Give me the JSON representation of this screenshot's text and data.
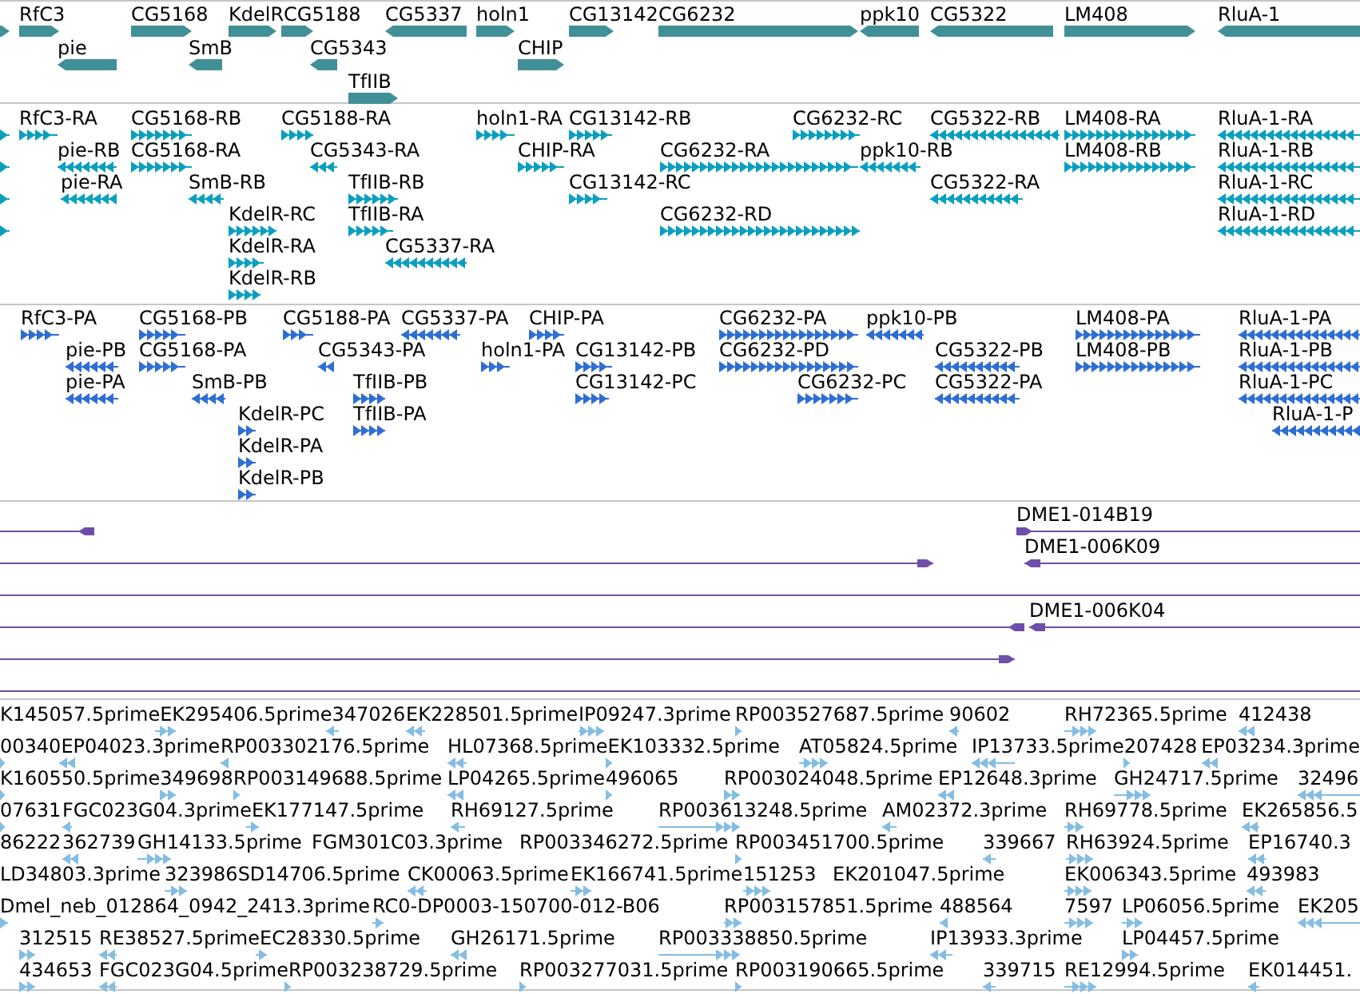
{
  "tracks": [
    {
      "kind": "gene",
      "rows": [
        {
          "features": [
            {
              "reverse": false
            },
            {
              "label": "RfC3",
              "reverse": false
            },
            {
              "label": "CG5168",
              "reverse": false
            },
            {
              "label": "KdelR",
              "reverse": false
            },
            {
              "label": "CG5188",
              "reverse": false
            },
            {
              "label": "CG5337",
              "reverse": true
            },
            {
              "label": "holn1",
              "reverse": false
            },
            {
              "label": "CG13142",
              "reverse": false
            },
            {
              "label": "CG6232",
              "reverse": false
            },
            {
              "label": "ppk10",
              "reverse": true
            },
            {
              "label": "CG5322",
              "reverse": true
            },
            {
              "label": "LM408",
              "reverse": false
            },
            {
              "label": "RluA-1",
              "reverse": true
            }
          ]
        },
        {
          "features": [
            {
              "label": "pie",
              "reverse": true
            },
            {
              "label": "SmB",
              "reverse": true
            },
            {
              "label": "CG5343",
              "reverse": true
            },
            {
              "label": "CHIP",
              "reverse": false
            }
          ]
        },
        {
          "features": [
            {
              "label": "TfIIB",
              "reverse": false
            }
          ]
        }
      ]
    },
    {
      "kind": "transcript",
      "rows": [
        {
          "features": [
            {
              "reverse": false
            },
            {
              "label": "RfC3-RA",
              "reverse": false
            },
            {
              "label": "CG5168-RB",
              "reverse": false
            },
            {
              "label": "CG5188-RA",
              "reverse": false
            },
            {
              "label": "holn1-RA",
              "reverse": false
            },
            {
              "label": "CG13142-RB",
              "reverse": false
            },
            {
              "label": "CG6232-RC",
              "reverse": false
            },
            {
              "label": "CG5322-RB",
              "reverse": true
            },
            {
              "label": "LM408-RA",
              "reverse": false
            },
            {
              "label": "RluA-1-RA",
              "reverse": true
            }
          ]
        },
        {
          "features": [
            {
              "reverse": false
            },
            {
              "label": "pie-RB",
              "reverse": true
            },
            {
              "label": "CG5168-RA",
              "reverse": false
            },
            {
              "label": "CG5343-RA",
              "reverse": true
            },
            {
              "label": "CHIP-RA",
              "reverse": false
            },
            {
              "label": "CG6232-RA",
              "reverse": false
            },
            {
              "label": "ppk10-RB",
              "reverse": true
            },
            {
              "label": "LM408-RB",
              "reverse": false
            },
            {
              "label": "RluA-1-RB",
              "reverse": true
            }
          ]
        },
        {
          "features": [
            {
              "reverse": false
            },
            {
              "label": "pie-RA",
              "reverse": true
            },
            {
              "label": "SmB-RB",
              "reverse": true
            },
            {
              "label": "TfIIB-RB",
              "reverse": false
            },
            {
              "label": "CG13142-RC",
              "reverse": false
            },
            {
              "label": "CG5322-RA",
              "reverse": true
            },
            {
              "label": "RluA-1-RC",
              "reverse": true
            }
          ]
        },
        {
          "features": [
            {
              "reverse": false
            },
            {
              "label": "KdelR-RC",
              "reverse": false
            },
            {
              "label": "TfIIB-RA",
              "reverse": false
            },
            {
              "label": "CG6232-RD",
              "reverse": false
            },
            {
              "label": "RluA-1-RD",
              "reverse": true
            }
          ]
        },
        {
          "features": [
            {
              "label": "KdelR-RA",
              "reverse": false
            },
            {
              "label": "CG5337-RA",
              "reverse": true
            }
          ]
        },
        {
          "features": [
            {
              "label": "KdelR-RB",
              "reverse": false
            }
          ]
        }
      ]
    },
    {
      "kind": "protein",
      "rows": [
        {
          "features": [
            {
              "label": "RfC3-PA",
              "reverse": false
            },
            {
              "label": "CG5168-PB",
              "reverse": false
            },
            {
              "label": "CG5188-PA",
              "reverse": false
            },
            {
              "label": "CG5337-PA",
              "reverse": true
            },
            {
              "label": "CHIP-PA",
              "reverse": false
            },
            {
              "label": "CG6232-PA",
              "reverse": false
            },
            {
              "label": "ppk10-PB",
              "reverse": true
            },
            {
              "label": "LM408-PA",
              "reverse": false
            },
            {
              "label": "RluA-1-PA",
              "reverse": true
            }
          ]
        },
        {
          "features": [
            {
              "label": "pie-PB",
              "reverse": true
            },
            {
              "label": "CG5168-PA",
              "reverse": false
            },
            {
              "label": "CG5343-PA",
              "reverse": true
            },
            {
              "label": "holn1-PA",
              "reverse": false
            },
            {
              "label": "CG13142-PB",
              "reverse": false
            },
            {
              "label": "CG6232-PD",
              "reverse": false
            },
            {
              "label": "CG5322-PB",
              "reverse": true
            },
            {
              "label": "LM408-PB",
              "reverse": false
            },
            {
              "label": "RluA-1-PB",
              "reverse": true
            }
          ]
        },
        {
          "features": [
            {
              "label": "pie-PA",
              "reverse": true
            },
            {
              "label": "SmB-PB",
              "reverse": true
            },
            {
              "label": "TfIIB-PB",
              "reverse": false
            },
            {
              "label": "CG13142-PC",
              "reverse": false
            },
            {
              "label": "CG6232-PC",
              "reverse": false
            },
            {
              "label": "CG5322-PA",
              "reverse": true
            },
            {
              "label": "RluA-1-PC",
              "reverse": true
            }
          ]
        },
        {
          "features": [
            {
              "label": "KdelR-PC",
              "reverse": false
            },
            {
              "label": "TfIIB-PA",
              "reverse": false
            },
            {
              "label": "RluA-1-P",
              "reverse": true
            }
          ]
        },
        {
          "features": [
            {
              "label": "KdelR-PA",
              "reverse": false
            }
          ]
        },
        {
          "features": [
            {
              "label": "KdelR-PB",
              "reverse": false
            }
          ]
        }
      ]
    },
    {
      "kind": "clone",
      "rows": [
        {
          "features": [
            {
              "kind": "arrow",
              "reverse": true
            },
            {
              "kind": "arrow",
              "label": "DME1-014B19",
              "reverse": false
            }
          ]
        },
        {
          "features": [
            {
              "kind": "arrow",
              "reverse": false
            },
            {
              "kind": "arrow",
              "label": "DME1-006K09",
              "reverse": true
            }
          ]
        },
        {
          "features": [
            {
              "kind": "line"
            }
          ]
        },
        {
          "features": [
            {
              "kind": "arrow",
              "reverse": true
            },
            {
              "kind": "arrow",
              "label": "DME1-006K04",
              "reverse": true
            }
          ]
        },
        {
          "features": [
            {
              "kind": "arrow",
              "reverse": false
            }
          ]
        },
        {
          "features": [
            {
              "kind": "line"
            }
          ]
        }
      ]
    },
    {
      "kind": "read",
      "rows": [
        {
          "features": [
            {
              "label": "K145057.5prime"
            },
            {
              "label": "EK295406.5prime",
              "reverse": false
            },
            {
              "label": "347026",
              "reverse": true
            },
            {
              "label": "EK228501.5prime",
              "reverse": true
            },
            {
              "label": "IP09247.3prime",
              "reverse": false
            },
            {
              "label": "RP003527687.5prime",
              "reverse": false
            },
            {
              "label": "90602",
              "reverse": true
            },
            {
              "label": "RH72365.5prime",
              "reverse": false
            },
            {
              "label": "412438",
              "reverse": true
            }
          ]
        },
        {
          "features": [
            {
              "label": "00340",
              "reverse": false
            },
            {
              "label": "EP04023.3prime",
              "reverse": true
            },
            {
              "label": "RP003302176.5prime",
              "reverse": true
            },
            {
              "label": "HL07368.5prime",
              "reverse": true
            },
            {
              "label": "EK103332.5prime",
              "reverse": false
            },
            {
              "label": "AT05824.5prime",
              "reverse": false
            },
            {
              "label": "IP13733.5prime",
              "reverse": true
            },
            {
              "label": "207428",
              "reverse": false
            },
            {
              "label": "EP03234.3prime",
              "reverse": true
            }
          ]
        },
        {
          "features": [
            {
              "label": "K160550.5prime",
              "reverse": false
            },
            {
              "label": "349698",
              "reverse": false
            },
            {
              "label": "RP003149688.5prime",
              "reverse": false
            },
            {
              "label": "LP04265.5prime",
              "reverse": true
            },
            {
              "label": "496065",
              "reverse": false
            },
            {
              "label": "RP003024048.5prime",
              "reverse": false
            },
            {
              "label": "EP12648.3prime",
              "reverse": true
            },
            {
              "label": "GH24717.5prime",
              "reverse": false
            },
            {
              "label": "32496",
              "reverse": true
            }
          ]
        },
        {
          "features": [
            {
              "label": "07631",
              "reverse": false
            },
            {
              "label": "FGC023G04.3prime",
              "reverse": true
            },
            {
              "label": "EK177147.5prime",
              "reverse": false
            },
            {
              "label": "RH69127.5prime",
              "reverse": true
            },
            {
              "label": "RP003613248.5prime",
              "reverse": false
            },
            {
              "label": "AM02372.3prime",
              "reverse": true
            },
            {
              "label": "RH69778.5prime",
              "reverse": false
            },
            {
              "label": "EK265856.5",
              "reverse": true
            }
          ]
        },
        {
          "features": [
            {
              "label": "86222"
            },
            {
              "label": "362739",
              "reverse": true
            },
            {
              "label": "GH14133.5prime",
              "reverse": false
            },
            {
              "label": "FGM301C03.3prime"
            },
            {
              "label": "RP003346272.5prime"
            },
            {
              "label": "RP003451700.5prime",
              "reverse": false
            },
            {
              "label": "339667",
              "reverse": true
            },
            {
              "label": "RH63924.5prime",
              "reverse": false
            },
            {
              "label": "EP16740.3",
              "reverse": true
            }
          ]
        },
        {
          "features": [
            {
              "label": "LD34803.3prime"
            },
            {
              "label": "323986",
              "reverse": false
            },
            {
              "label": "SD14706.5prime"
            },
            {
              "label": "CK00063.5prime",
              "reverse": true
            },
            {
              "label": "EK166741.5prime",
              "reverse": false
            },
            {
              "label": "151253",
              "reverse": false
            },
            {
              "label": "EK201047.5prime"
            },
            {
              "label": "EK006343.5prime",
              "reverse": false
            },
            {
              "label": "493983",
              "reverse": true
            }
          ]
        },
        {
          "features": [
            {
              "label": "Dmel_neb_012864_0942_2413.3prime",
              "reverse": false
            },
            {
              "label": "RC0-DP0003-150700-012-B06",
              "reverse": false
            },
            {
              "label": "RP003157851.5prime",
              "reverse": false
            },
            {
              "label": "488564",
              "reverse": true
            },
            {
              "label": "7597",
              "reverse": false
            },
            {
              "label": "LP06056.5prime",
              "reverse": false
            },
            {
              "label": "EK205",
              "reverse": true
            }
          ]
        },
        {
          "features": [
            {
              "label": "312515",
              "reverse": false
            },
            {
              "label": "RE38527.5prime",
              "reverse": true
            },
            {
              "label": "EC28330.5prime",
              "reverse": false
            },
            {
              "label": "GH26171.5prime",
              "reverse": true
            },
            {
              "label": "RP003338850.5prime",
              "reverse": false
            },
            {
              "label": "IP13933.3prime",
              "reverse": true
            },
            {
              "label": "LP04457.5prime",
              "reverse": false
            }
          ]
        },
        {
          "features": [
            {
              "label": "434653",
              "reverse": false
            },
            {
              "label": "FGC023G04.5prime",
              "reverse": true
            },
            {
              "label": "RP003238729.5prime",
              "reverse": false
            },
            {
              "label": "RP003277031.5prime",
              "reverse": false
            },
            {
              "label": "RP003190665.5prime",
              "reverse": false
            },
            {
              "label": "339715",
              "reverse": true
            },
            {
              "label": "RE12994.5prime",
              "reverse": false
            },
            {
              "label": "EK014451.",
              "reverse": true
            }
          ]
        }
      ]
    }
  ]
}
